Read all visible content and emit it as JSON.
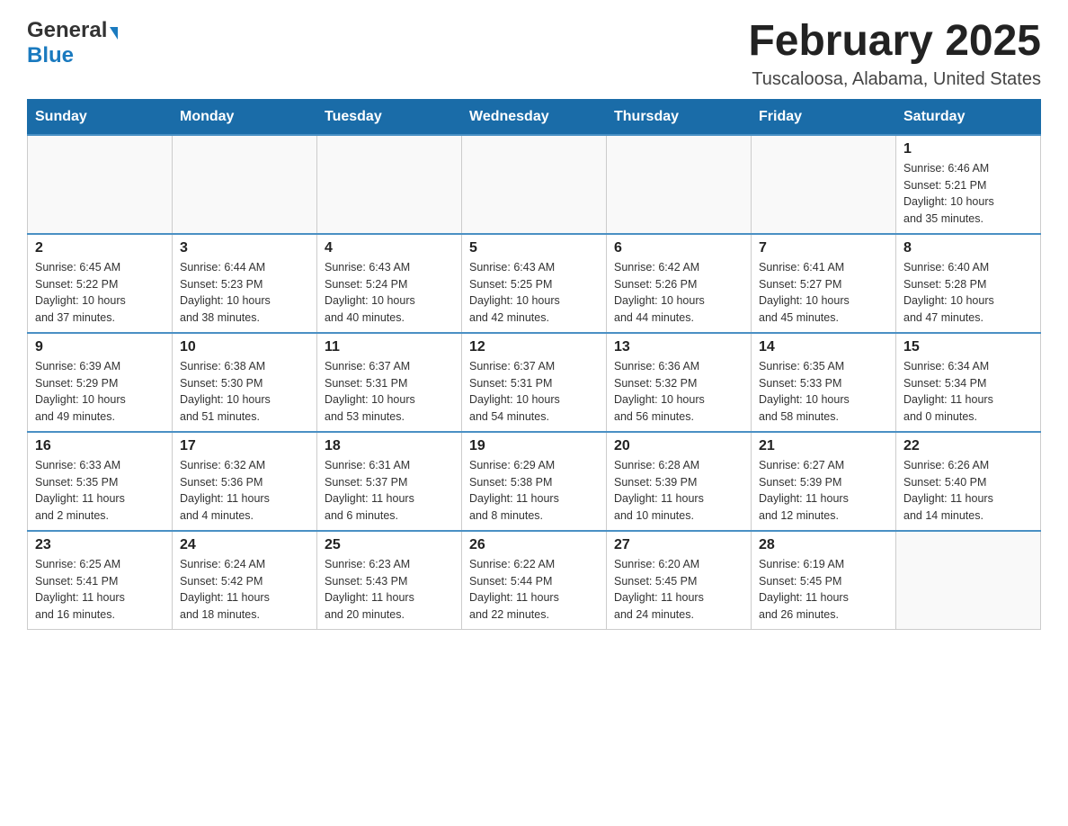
{
  "header": {
    "logo_general": "General",
    "logo_blue": "Blue",
    "month_title": "February 2025",
    "location": "Tuscaloosa, Alabama, United States"
  },
  "days_of_week": [
    "Sunday",
    "Monday",
    "Tuesday",
    "Wednesday",
    "Thursday",
    "Friday",
    "Saturday"
  ],
  "weeks": [
    [
      {
        "day": "",
        "info": ""
      },
      {
        "day": "",
        "info": ""
      },
      {
        "day": "",
        "info": ""
      },
      {
        "day": "",
        "info": ""
      },
      {
        "day": "",
        "info": ""
      },
      {
        "day": "",
        "info": ""
      },
      {
        "day": "1",
        "info": "Sunrise: 6:46 AM\nSunset: 5:21 PM\nDaylight: 10 hours\nand 35 minutes."
      }
    ],
    [
      {
        "day": "2",
        "info": "Sunrise: 6:45 AM\nSunset: 5:22 PM\nDaylight: 10 hours\nand 37 minutes."
      },
      {
        "day": "3",
        "info": "Sunrise: 6:44 AM\nSunset: 5:23 PM\nDaylight: 10 hours\nand 38 minutes."
      },
      {
        "day": "4",
        "info": "Sunrise: 6:43 AM\nSunset: 5:24 PM\nDaylight: 10 hours\nand 40 minutes."
      },
      {
        "day": "5",
        "info": "Sunrise: 6:43 AM\nSunset: 5:25 PM\nDaylight: 10 hours\nand 42 minutes."
      },
      {
        "day": "6",
        "info": "Sunrise: 6:42 AM\nSunset: 5:26 PM\nDaylight: 10 hours\nand 44 minutes."
      },
      {
        "day": "7",
        "info": "Sunrise: 6:41 AM\nSunset: 5:27 PM\nDaylight: 10 hours\nand 45 minutes."
      },
      {
        "day": "8",
        "info": "Sunrise: 6:40 AM\nSunset: 5:28 PM\nDaylight: 10 hours\nand 47 minutes."
      }
    ],
    [
      {
        "day": "9",
        "info": "Sunrise: 6:39 AM\nSunset: 5:29 PM\nDaylight: 10 hours\nand 49 minutes."
      },
      {
        "day": "10",
        "info": "Sunrise: 6:38 AM\nSunset: 5:30 PM\nDaylight: 10 hours\nand 51 minutes."
      },
      {
        "day": "11",
        "info": "Sunrise: 6:37 AM\nSunset: 5:31 PM\nDaylight: 10 hours\nand 53 minutes."
      },
      {
        "day": "12",
        "info": "Sunrise: 6:37 AM\nSunset: 5:31 PM\nDaylight: 10 hours\nand 54 minutes."
      },
      {
        "day": "13",
        "info": "Sunrise: 6:36 AM\nSunset: 5:32 PM\nDaylight: 10 hours\nand 56 minutes."
      },
      {
        "day": "14",
        "info": "Sunrise: 6:35 AM\nSunset: 5:33 PM\nDaylight: 10 hours\nand 58 minutes."
      },
      {
        "day": "15",
        "info": "Sunrise: 6:34 AM\nSunset: 5:34 PM\nDaylight: 11 hours\nand 0 minutes."
      }
    ],
    [
      {
        "day": "16",
        "info": "Sunrise: 6:33 AM\nSunset: 5:35 PM\nDaylight: 11 hours\nand 2 minutes."
      },
      {
        "day": "17",
        "info": "Sunrise: 6:32 AM\nSunset: 5:36 PM\nDaylight: 11 hours\nand 4 minutes."
      },
      {
        "day": "18",
        "info": "Sunrise: 6:31 AM\nSunset: 5:37 PM\nDaylight: 11 hours\nand 6 minutes."
      },
      {
        "day": "19",
        "info": "Sunrise: 6:29 AM\nSunset: 5:38 PM\nDaylight: 11 hours\nand 8 minutes."
      },
      {
        "day": "20",
        "info": "Sunrise: 6:28 AM\nSunset: 5:39 PM\nDaylight: 11 hours\nand 10 minutes."
      },
      {
        "day": "21",
        "info": "Sunrise: 6:27 AM\nSunset: 5:39 PM\nDaylight: 11 hours\nand 12 minutes."
      },
      {
        "day": "22",
        "info": "Sunrise: 6:26 AM\nSunset: 5:40 PM\nDaylight: 11 hours\nand 14 minutes."
      }
    ],
    [
      {
        "day": "23",
        "info": "Sunrise: 6:25 AM\nSunset: 5:41 PM\nDaylight: 11 hours\nand 16 minutes."
      },
      {
        "day": "24",
        "info": "Sunrise: 6:24 AM\nSunset: 5:42 PM\nDaylight: 11 hours\nand 18 minutes."
      },
      {
        "day": "25",
        "info": "Sunrise: 6:23 AM\nSunset: 5:43 PM\nDaylight: 11 hours\nand 20 minutes."
      },
      {
        "day": "26",
        "info": "Sunrise: 6:22 AM\nSunset: 5:44 PM\nDaylight: 11 hours\nand 22 minutes."
      },
      {
        "day": "27",
        "info": "Sunrise: 6:20 AM\nSunset: 5:45 PM\nDaylight: 11 hours\nand 24 minutes."
      },
      {
        "day": "28",
        "info": "Sunrise: 6:19 AM\nSunset: 5:45 PM\nDaylight: 11 hours\nand 26 minutes."
      },
      {
        "day": "",
        "info": ""
      }
    ]
  ]
}
